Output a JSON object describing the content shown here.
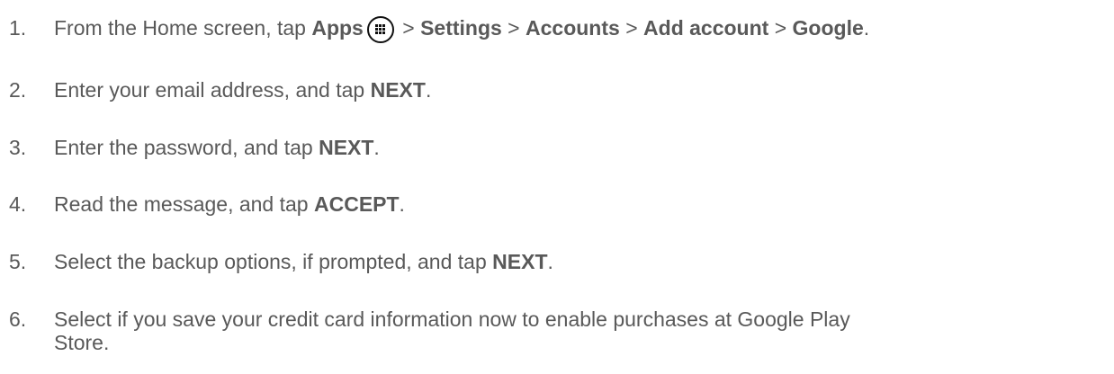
{
  "steps": [
    {
      "number": "1.",
      "parts": [
        {
          "t": "From the Home screen, tap "
        },
        {
          "b": "Apps"
        },
        {
          "icon": "apps-grid-icon"
        },
        {
          "t": " > "
        },
        {
          "b": "Settings"
        },
        {
          "t": " > "
        },
        {
          "b": "Accounts"
        },
        {
          "t": " > "
        },
        {
          "b": "Add account"
        },
        {
          "t": " > "
        },
        {
          "b": "Google"
        },
        {
          "t": "."
        }
      ]
    },
    {
      "number": "2.",
      "parts": [
        {
          "t": "Enter your email address, and tap "
        },
        {
          "b": "NEXT"
        },
        {
          "t": "."
        }
      ]
    },
    {
      "number": "3.",
      "parts": [
        {
          "t": "Enter the password, and tap "
        },
        {
          "b": "NEXT"
        },
        {
          "t": "."
        }
      ]
    },
    {
      "number": "4.",
      "parts": [
        {
          "t": "Read the message, and tap "
        },
        {
          "b": "ACCEPT"
        },
        {
          "t": "."
        }
      ]
    },
    {
      "number": "5.",
      "parts": [
        {
          "t": "Select the backup options, if prompted, and tap "
        },
        {
          "b": "NEXT"
        },
        {
          "t": "."
        }
      ]
    },
    {
      "number": "6.",
      "parts": [
        {
          "t": "Select if you save your credit card information now to enable purchases at Google Play"
        }
      ],
      "continuation": "Store."
    }
  ]
}
